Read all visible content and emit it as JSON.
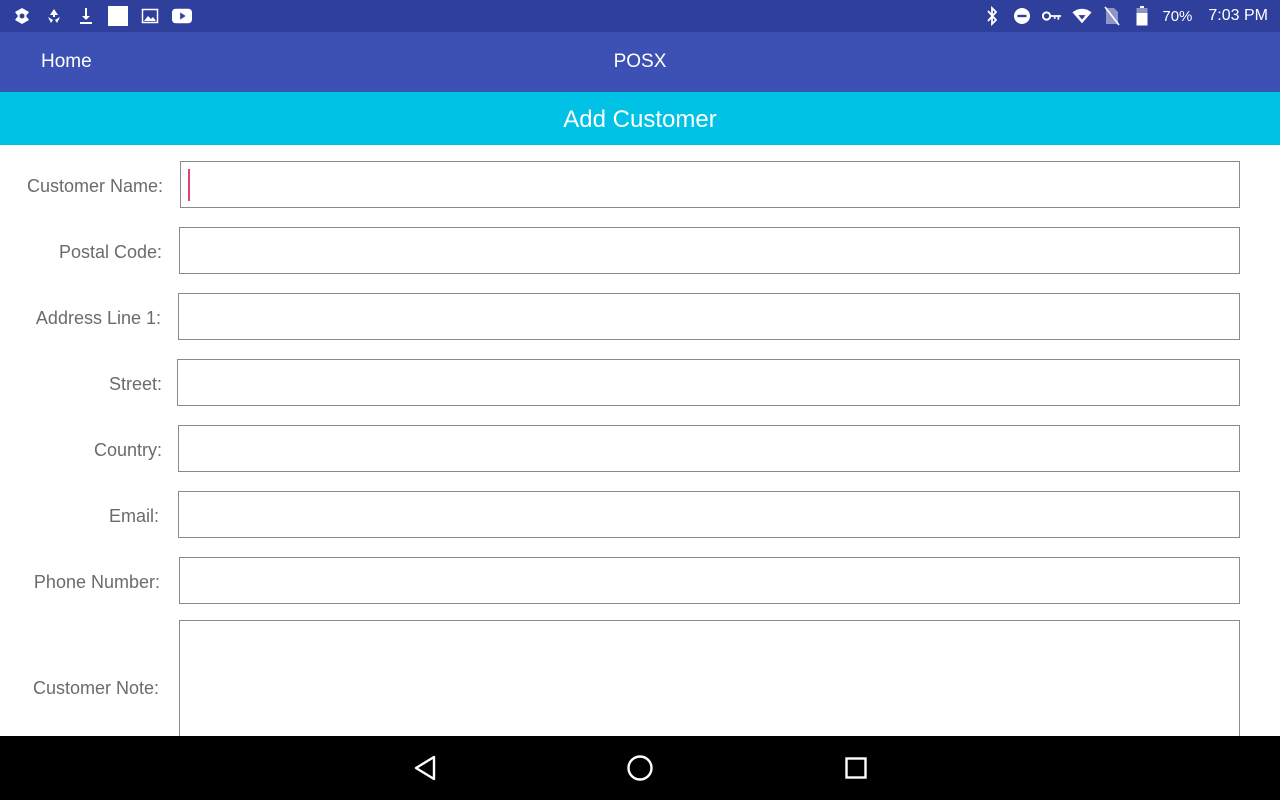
{
  "status_bar": {
    "left_icons": [
      "pinwheel-app-icon",
      "recycle-app-icon",
      "download-icon",
      "blank-notification-icon",
      "image-icon",
      "youtube-icon"
    ],
    "right_icons": [
      "bluetooth-icon",
      "do-not-disturb-icon",
      "vpn-key-icon",
      "wifi-icon",
      "no-sim-icon",
      "battery-icon"
    ],
    "battery": "70%",
    "time": "7:03 PM"
  },
  "app_bar": {
    "home_label": "Home",
    "title": "POSX"
  },
  "section": {
    "title": "Add Customer"
  },
  "form": {
    "fields": [
      {
        "label": "Customer Name:",
        "value": "",
        "focused": true
      },
      {
        "label": "Postal Code:",
        "value": ""
      },
      {
        "label": "Address Line 1:",
        "value": ""
      },
      {
        "label": "Street:",
        "value": ""
      },
      {
        "label": "Country:",
        "value": ""
      },
      {
        "label": "Email:",
        "value": ""
      },
      {
        "label": "Phone Number:",
        "value": ""
      },
      {
        "label": "Customer Note:",
        "value": ""
      }
    ]
  },
  "nav_bar": {
    "buttons": [
      "back-icon",
      "home-circle-icon",
      "recents-icon"
    ]
  },
  "colors": {
    "status_bar": "#2e3f9c",
    "app_bar": "#3d51b4",
    "section_header": "#00c2e5",
    "caret": "#e0407a"
  }
}
